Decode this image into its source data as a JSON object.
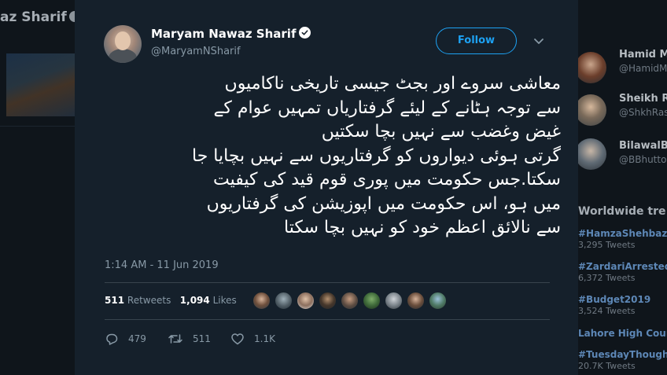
{
  "background": {
    "left_header": "az Sharif",
    "who_to_follow": [
      {
        "name": "Hamid M",
        "handle": "@HamidM"
      },
      {
        "name": "Sheikh Ra",
        "handle": "@ShkhRas"
      },
      {
        "name": "BilawalBh",
        "handle": "@BBhutto"
      }
    ],
    "trends_title": "Worldwide tre",
    "trends": [
      {
        "name": "#HamzaShehbaz",
        "count": "3,295 Tweets"
      },
      {
        "name": "#ZardariArrested",
        "count": "6,372 Tweets"
      },
      {
        "name": "#Budget2019",
        "count": "3,524 Tweets"
      },
      {
        "name": "Lahore High Cour",
        "count": ""
      },
      {
        "name": "#TuesdayThought",
        "count": "20.7K Tweets"
      }
    ]
  },
  "tweet": {
    "author_name": "Maryam Nawaz Sharif",
    "author_handle": "@MaryamNSharif",
    "follow_label": "Follow",
    "text_lines": [
      "معاشی سروے اور بجٹ جیسی تاریخی ناکامیوں",
      "سے توجہ ہٹانے کے لیئے گرفتاریاں تمہیں عوام کے",
      "غیض وغضب  سے نہیں بچا سکتیں",
      "گرتی ہوئی دیواروں کو گرفتاریوں سے نہیں بچایا جا",
      "سکتا.جس حکومت میں پوری قوم قید کی کیفیت",
      "میں ہو، اس حکومت میں اپوزیشن کی گرفتاریوں",
      "سے نالائق اعظم خود کو نہیں بچا سکتا"
    ],
    "timestamp": "1:14 AM - 11 Jun 2019",
    "retweets_count": "511",
    "retweets_label": "Retweets",
    "likes_count": "1,094",
    "likes_label": "Likes",
    "reply_count": "479",
    "retweet_action_count": "511",
    "like_action_count": "1.1K"
  }
}
